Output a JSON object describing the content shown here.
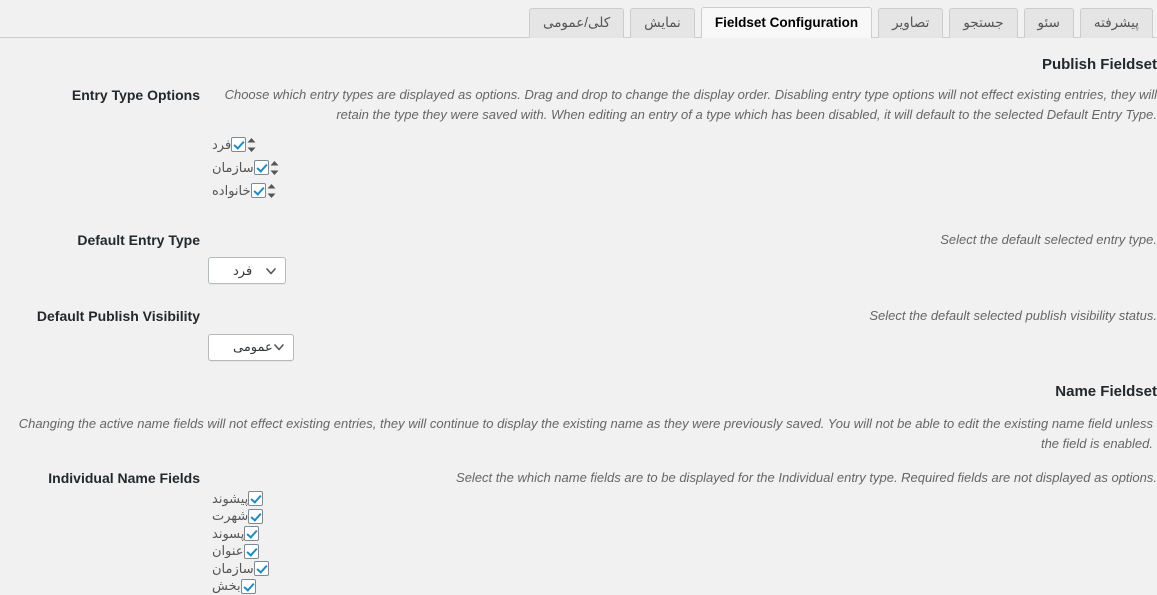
{
  "tabs": [
    {
      "label": "پیشرفته",
      "active": false,
      "name": "tab-advanced"
    },
    {
      "label": "سئو",
      "active": false,
      "name": "tab-seo"
    },
    {
      "label": "جستجو",
      "active": false,
      "name": "tab-search"
    },
    {
      "label": "تصاویر",
      "active": false,
      "name": "tab-images"
    },
    {
      "label": "Fieldset Configuration",
      "active": true,
      "name": "tab-fieldset-configuration"
    },
    {
      "label": "نمایش",
      "active": false,
      "name": "tab-display"
    },
    {
      "label": "کلی/عمومی",
      "active": false,
      "name": "tab-general"
    }
  ],
  "publish_fieldset": {
    "heading": "Publish Fieldset",
    "entry_type_options": {
      "label": "Entry Type Options",
      "description": "Choose which entry types are displayed as options. Drag and drop to change the display order. Disabling entry type options will not effect existing entries, they will retain the type they were saved with. When editing an entry of a type which has been disabled, it will default to the selected Default Entry Type.",
      "options": [
        {
          "label": "فرد",
          "checked": true
        },
        {
          "label": "سازمان",
          "checked": true
        },
        {
          "label": "خانواده",
          "checked": true
        }
      ]
    },
    "default_entry_type": {
      "label": "Default Entry Type",
      "description": "Select the default selected entry type.",
      "value": "فرد"
    },
    "default_publish_visibility": {
      "label": "Default Publish Visibility",
      "description": "Select the default selected publish visibility status.",
      "value": "عمومی"
    }
  },
  "name_fieldset": {
    "heading": "Name Fieldset",
    "description": "Changing the active name fields will not effect existing entries, they will continue to display the existing name as they were previously saved. You will not be able to edit the existing name field unless the field is enabled.",
    "individual_name_fields": {
      "label": "Individual Name Fields",
      "description": "Select the which name fields are to be displayed for the Individual entry type. Required fields are not displayed as options.",
      "options": [
        {
          "label": "پیشوند",
          "checked": true
        },
        {
          "label": "شهرت",
          "checked": true
        },
        {
          "label": "پسوند",
          "checked": true
        },
        {
          "label": "عنوان",
          "checked": true
        },
        {
          "label": "سازمان",
          "checked": true
        },
        {
          "label": "بخش",
          "checked": true
        }
      ]
    }
  },
  "icons": {
    "sort_handle": "sort-updown-icon",
    "chevron_down": "chevron-down-icon",
    "checkbox_check": "check-icon"
  },
  "colors": {
    "page_background": "#f1f1f1",
    "tab_inactive_background": "#e5e5e5",
    "tab_active_background": "#f8f8f8",
    "border": "#cccccc",
    "heading_text": "#23282d",
    "description_text": "#666666",
    "checkbox_accent": "#1e8cbe"
  }
}
